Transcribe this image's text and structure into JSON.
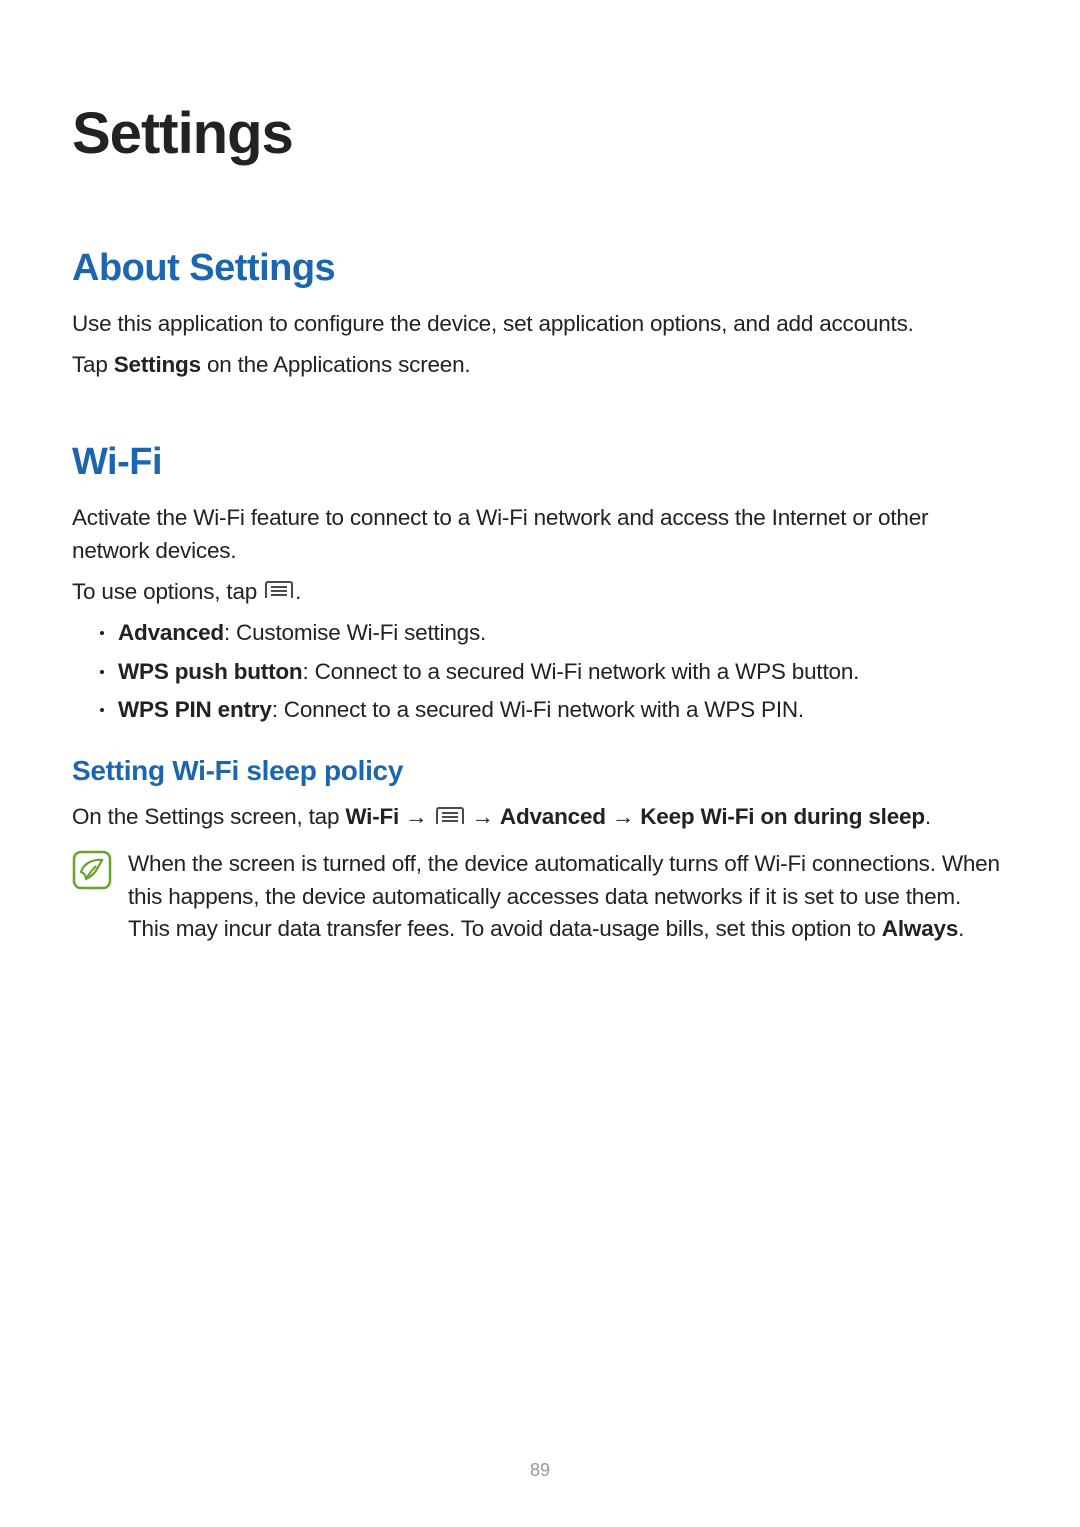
{
  "pageTitle": "Settings",
  "about": {
    "heading": "About Settings",
    "p1": "Use this application to configure the device, set application options, and add accounts.",
    "p2_pre": "Tap ",
    "p2_bold": "Settings",
    "p2_post": " on the Applications screen."
  },
  "wifi": {
    "heading": "Wi-Fi",
    "p1": "Activate the Wi-Fi feature to connect to a Wi-Fi network and access the Internet or other network devices.",
    "p2_pre": "To use options, tap ",
    "p2_post": ".",
    "bullets": [
      {
        "bold": "Advanced",
        "rest": ": Customise Wi-Fi settings."
      },
      {
        "bold": "WPS push button",
        "rest": ": Connect to a secured Wi-Fi network with a WPS button."
      },
      {
        "bold": "WPS PIN entry",
        "rest": ": Connect to a secured Wi-Fi network with a WPS PIN."
      }
    ],
    "sleep": {
      "heading": "Setting Wi-Fi sleep policy",
      "p1_pre": "On the Settings screen, tap ",
      "p1_b1": "Wi-Fi",
      "p1_arrow1": " → ",
      "p1_arrow2": " → ",
      "p1_b2": "Advanced",
      "p1_arrow3": " → ",
      "p1_b3": "Keep Wi-Fi on during sleep",
      "p1_post": "."
    },
    "note": {
      "text_pre": "When the screen is turned off, the device automatically turns off Wi-Fi connections. When this happens, the device automatically accesses data networks if it is set to use them. This may incur data transfer fees. To avoid data-usage bills, set this option to ",
      "text_bold": "Always",
      "text_post": "."
    }
  },
  "pageNumber": "89"
}
